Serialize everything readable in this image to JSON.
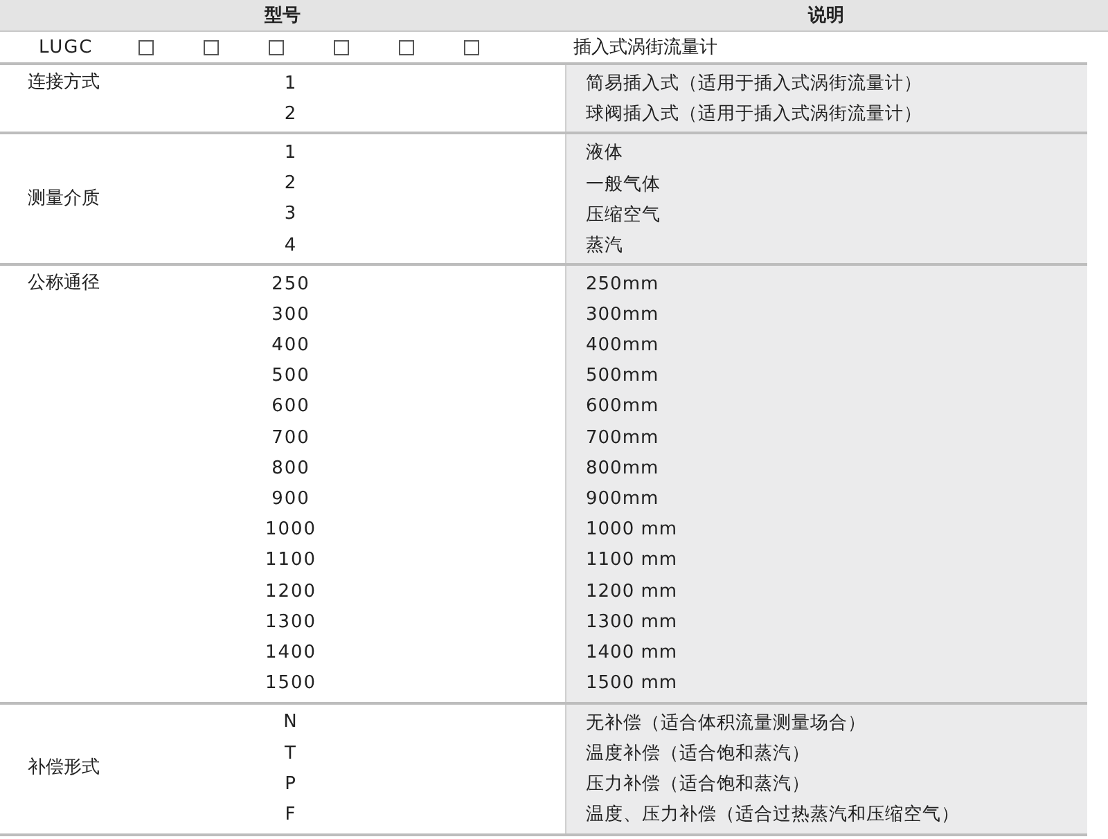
{
  "header": {
    "model": "型号",
    "description": "说明"
  },
  "model_row": {
    "code": "LUGC",
    "slots": [
      {
        "checked": false
      },
      {
        "checked": false
      },
      {
        "checked": false
      },
      {
        "checked": false
      },
      {
        "checked": false
      },
      {
        "checked": false
      }
    ],
    "description": "插入式涡街流量计"
  },
  "sections": [
    {
      "label": "连接方式",
      "label_centered": false,
      "options": [
        {
          "code": "1",
          "description": "简易插入式（适用于插入式涡街流量计）"
        },
        {
          "code": "2",
          "description": "球阀插入式（适用于插入式涡街流量计）"
        }
      ]
    },
    {
      "label": "测量介质",
      "label_centered": true,
      "options": [
        {
          "code": "1",
          "description": "液体"
        },
        {
          "code": "2",
          "description": "一般气体"
        },
        {
          "code": "3",
          "description": "压缩空气"
        },
        {
          "code": "4",
          "description": "蒸汽"
        }
      ]
    },
    {
      "label": "公称通径",
      "label_centered": false,
      "options": [
        {
          "code": "250",
          "description": "250mm"
        },
        {
          "code": "300",
          "description": "300mm"
        },
        {
          "code": "400",
          "description": "400mm"
        },
        {
          "code": "500",
          "description": "500mm"
        },
        {
          "code": "600",
          "description": "600mm"
        },
        {
          "code": "700",
          "description": "700mm"
        },
        {
          "code": "800",
          "description": "800mm"
        },
        {
          "code": "900",
          "description": "900mm"
        },
        {
          "code": "1000",
          "description": "1000 mm"
        },
        {
          "code": "1100",
          "description": "1100 mm"
        },
        {
          "code": "1200",
          "description": "1200 mm"
        },
        {
          "code": "1300",
          "description": "1300 mm"
        },
        {
          "code": "1400",
          "description": "1400 mm"
        },
        {
          "code": "1500",
          "description": "1500 mm"
        }
      ]
    },
    {
      "label": "补偿形式",
      "label_centered": true,
      "options": [
        {
          "code": "N",
          "description": "无补偿（适合体积流量测量场合）"
        },
        {
          "code": "T",
          "description": "温度补偿（适合饱和蒸汽）"
        },
        {
          "code": "P",
          "description": "压力补偿（适合饱和蒸汽）"
        },
        {
          "code": "F",
          "description": "温度、压力补偿（适合过热蒸汽和压缩空气）"
        }
      ]
    }
  ]
}
